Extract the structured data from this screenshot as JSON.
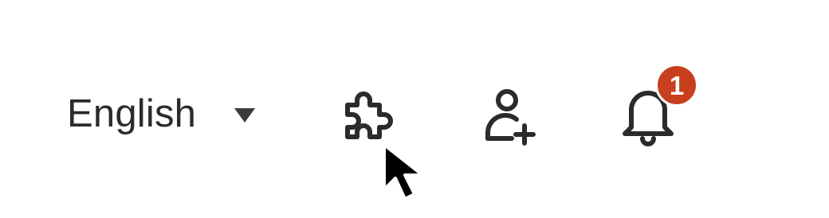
{
  "language_selector": {
    "selected": "English",
    "caret_icon": "caret-down-icon"
  },
  "header_actions": {
    "extensions_icon": "puzzle-icon",
    "add_user_icon": "add-user-icon",
    "notifications_icon": "bell-icon",
    "notification_count": "1"
  },
  "colors": {
    "icon": "#2b2b2b",
    "badge": "#c83f1d",
    "background": "#ffffff"
  }
}
